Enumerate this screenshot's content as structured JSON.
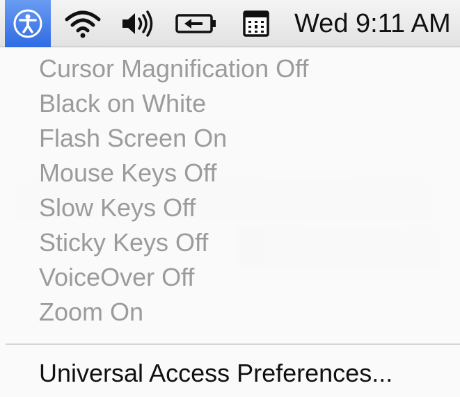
{
  "menubar": {
    "icons": [
      "universal-access-icon",
      "wifi-icon",
      "volume-icon",
      "battery-icon",
      "calendar-icon"
    ],
    "clock": "Wed 9:11 AM",
    "highlight_color": "#3a78e8"
  },
  "menu": {
    "items": [
      {
        "label": "Cursor Magnification Off",
        "enabled": false
      },
      {
        "label": "Black on White",
        "enabled": false
      },
      {
        "label": "Flash Screen On",
        "enabled": false
      },
      {
        "label": "Mouse Keys Off",
        "enabled": false
      },
      {
        "label": "Slow Keys Off",
        "enabled": false
      },
      {
        "label": "Sticky Keys Off",
        "enabled": false
      },
      {
        "label": "VoiceOver Off",
        "enabled": false
      },
      {
        "label": "Zoom On",
        "enabled": false
      }
    ],
    "preferences_label": "Universal Access Preferences...",
    "disabled_text_color": "#9b9b9b",
    "enabled_text_color": "#111111"
  }
}
